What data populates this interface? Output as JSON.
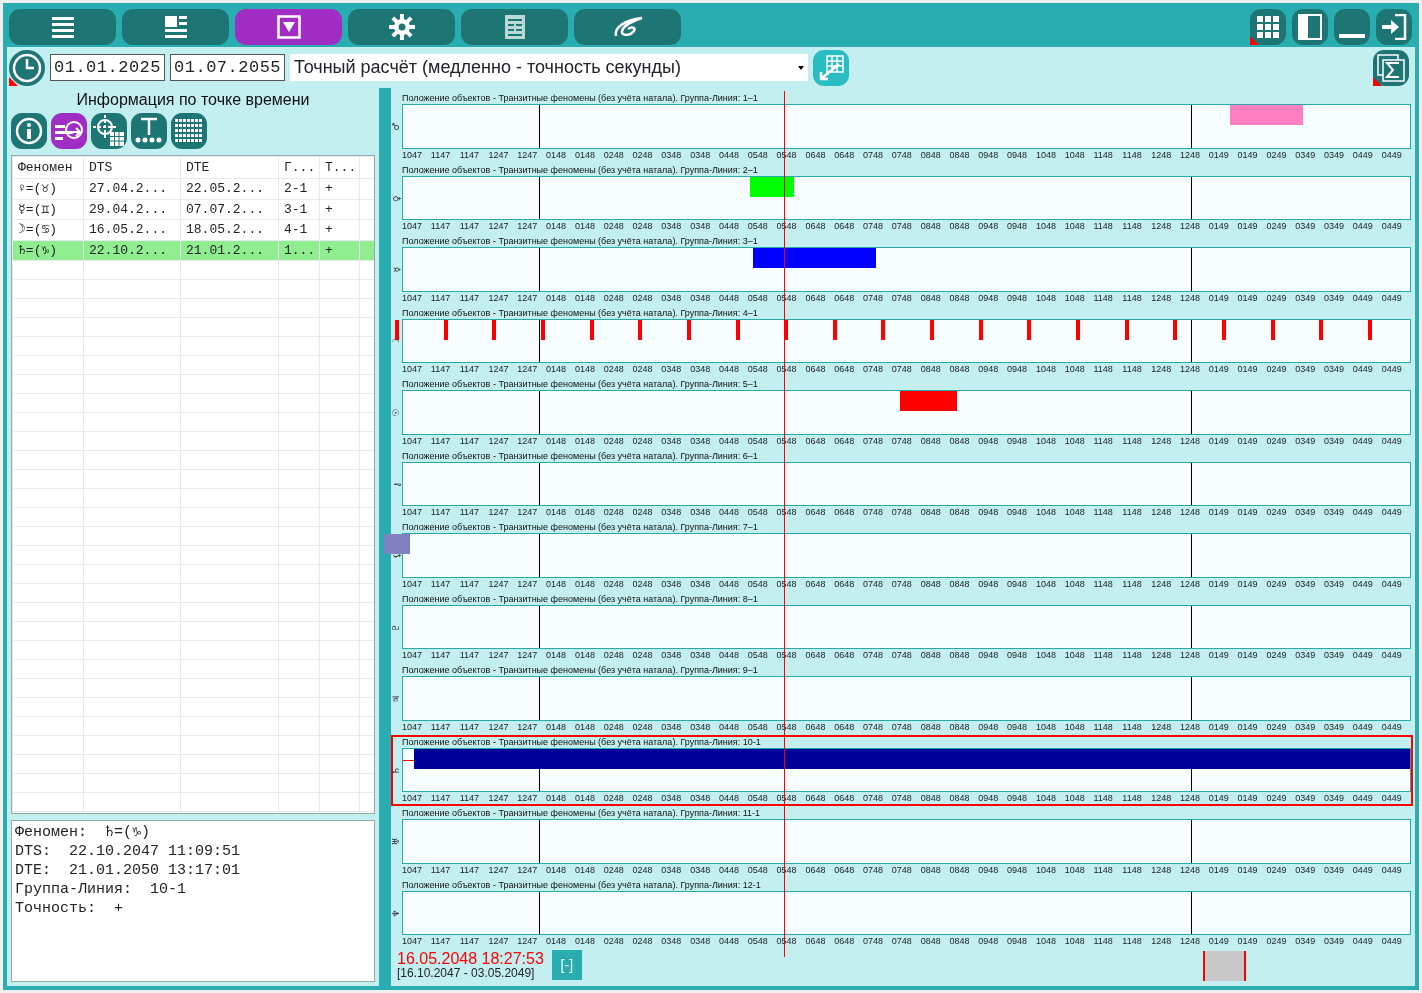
{
  "main_tabs": [
    {
      "selected": false
    },
    {
      "selected": false
    },
    {
      "selected": true
    },
    {
      "selected": false
    },
    {
      "selected": false
    },
    {
      "selected": false
    }
  ],
  "period": {
    "start": "01.01.2025",
    "end": "01.07.2055",
    "mode": "Точный расчёт (медленно - точность секунды)"
  },
  "info_panel": {
    "title": "Информация по точке времени",
    "tools": [
      {
        "selected": false
      },
      {
        "selected": true
      },
      {
        "selected": false
      },
      {
        "selected": false
      },
      {
        "selected": false
      }
    ],
    "table": {
      "columns": [
        "Феномен",
        "DTS",
        "DTE",
        "Г...",
        "Т..."
      ],
      "rows": [
        {
          "cells": [
            "♀=(♉)",
            "27.04.2...",
            "22.05.2...",
            "2-1",
            "+"
          ],
          "selected": false
        },
        {
          "cells": [
            "☿=(♊)",
            "29.04.2...",
            "07.07.2...",
            "3-1",
            "+"
          ],
          "selected": false
        },
        {
          "cells": [
            "☽=(♋)",
            "16.05.2...",
            "18.05.2...",
            "4-1",
            "+"
          ],
          "selected": false
        },
        {
          "cells": [
            "♄=(♑)",
            "22.10.2...",
            "21.01.2...",
            "1...",
            "+"
          ],
          "selected": true
        }
      ]
    },
    "details": [
      "Феномен:  ♄=(♑)",
      "DTS:  22.10.2047 11:09:51",
      "DTE:  21.01.2050 13:17:01",
      "Группа-Линия:  10-1",
      "Точность:  +"
    ]
  },
  "timeline": {
    "tracks": [
      {
        "symbol": "♂",
        "title": "Положение объектов - Транзитные феномены (без учёта натала). Группа-Линия: 1–1",
        "selected": false,
        "mark": {
          "kind": "bar",
          "color": "#ff80c0"
        },
        "ticks": [
          "1047",
          "1147",
          "1147",
          "1247",
          "1247",
          "0148",
          "0148",
          "0248",
          "0248",
          "0348",
          "0348",
          "0448",
          "0548",
          "0548",
          "0648",
          "0648",
          "0748",
          "0748",
          "0848",
          "0848",
          "0948",
          "0948",
          "1048",
          "1048",
          "1148",
          "1148",
          "1248",
          "1248",
          "0149",
          "0149",
          "0249",
          "0349",
          "0349",
          "0449",
          "0449"
        ]
      },
      {
        "symbol": "♀",
        "title": "Положение объектов - Транзитные феномены (без учёта натала). Группа-Линия: 2–1",
        "selected": false,
        "mark": {
          "kind": "bar",
          "color": "#00ff00"
        },
        "ticks": [
          "1047",
          "1147",
          "1147",
          "1247",
          "1247",
          "0148",
          "0148",
          "0248",
          "0248",
          "0348",
          "0348",
          "0448",
          "0548",
          "0548",
          "0648",
          "0648",
          "0748",
          "0748",
          "0848",
          "0848",
          "0948",
          "0948",
          "1048",
          "1048",
          "1148",
          "1148",
          "1248",
          "1248",
          "0149",
          "0149",
          "0249",
          "0349",
          "0349",
          "0449",
          "0449"
        ]
      },
      {
        "symbol": "☿",
        "title": "Положение объектов - Транзитные феномены (без учёта натала). Группа-Линия: 3–1",
        "selected": false,
        "mark": {
          "kind": "bar",
          "color": "#0000ff"
        },
        "ticks": [
          "1047",
          "1147",
          "1147",
          "1247",
          "1247",
          "0148",
          "0148",
          "0248",
          "0248",
          "0348",
          "0348",
          "0448",
          "0548",
          "0548",
          "0648",
          "0648",
          "0748",
          "0748",
          "0848",
          "0848",
          "0948",
          "0948",
          "1048",
          "1048",
          "1148",
          "1148",
          "1248",
          "1248",
          "0149",
          "0149",
          "0249",
          "0349",
          "0349",
          "0449",
          "0449"
        ]
      },
      {
        "symbol": "☽",
        "title": "Положение объектов - Транзитные феномены (без учёта натала). Группа-Линия: 4–1",
        "selected": false,
        "mark": {
          "kind": "ticks",
          "color": "#ff0000"
        },
        "ticks": [
          "1047",
          "1147",
          "1147",
          "1247",
          "1247",
          "0148",
          "0148",
          "0248",
          "0248",
          "0348",
          "0348",
          "0448",
          "0548",
          "0548",
          "0648",
          "0648",
          "0748",
          "0748",
          "0848",
          "0848",
          "0948",
          "0948",
          "1048",
          "1048",
          "1148",
          "1148",
          "1248",
          "1248",
          "0149",
          "0149",
          "0249",
          "0349",
          "0349",
          "0449",
          "0449"
        ]
      },
      {
        "symbol": "☉",
        "title": "Положение объектов - Транзитные феномены (без учёта натала). Группа-Линия: 5–1",
        "selected": false,
        "mark": {
          "kind": "bar",
          "color": "#ff0000"
        },
        "ticks": [
          "1047",
          "1147",
          "1147",
          "1247",
          "1247",
          "0148",
          "0148",
          "0248",
          "0248",
          "0348",
          "0348",
          "0448",
          "0548",
          "0548",
          "0648",
          "0648",
          "0748",
          "0748",
          "0848",
          "0848",
          "0948",
          "0948",
          "1048",
          "1048",
          "1148",
          "1148",
          "1248",
          "1248",
          "0149",
          "0149",
          "0249",
          "0349",
          "0349",
          "0449",
          "0449"
        ]
      },
      {
        "symbol": "⚷",
        "title": "Положение объектов - Транзитные феномены (без учёта натала). Группа-Линия: 6–1",
        "selected": false,
        "ticks": [
          "1047",
          "1147",
          "1147",
          "1247",
          "1247",
          "0148",
          "0148",
          "0248",
          "0248",
          "0348",
          "0348",
          "0448",
          "0548",
          "0548",
          "0648",
          "0648",
          "0748",
          "0748",
          "0848",
          "0848",
          "0948",
          "0948",
          "1048",
          "1048",
          "1148",
          "1148",
          "1248",
          "1248",
          "0149",
          "0149",
          "0249",
          "0349",
          "0349",
          "0449",
          "0449"
        ]
      },
      {
        "symbol": "⚸",
        "title": "Положение объектов - Транзитные феномены (без учёта натала). Группа-Линия: 7–1",
        "selected": false,
        "mark": {
          "kind": "bar",
          "color": "#8080c0"
        },
        "ticks": [
          "1047",
          "1147",
          "1147",
          "1247",
          "1247",
          "0148",
          "0148",
          "0248",
          "0248",
          "0348",
          "0348",
          "0448",
          "0548",
          "0548",
          "0648",
          "0648",
          "0748",
          "0748",
          "0848",
          "0848",
          "0948",
          "0948",
          "1048",
          "1048",
          "1148",
          "1148",
          "1248",
          "1248",
          "0149",
          "0149",
          "0249",
          "0349",
          "0349",
          "0449",
          "0449"
        ]
      },
      {
        "symbol": "♇",
        "title": "Положение объектов - Транзитные феномены (без учёта натала). Группа-Линия: 8–1",
        "selected": false,
        "ticks": [
          "1047",
          "1147",
          "1147",
          "1247",
          "1247",
          "0148",
          "0148",
          "0248",
          "0248",
          "0348",
          "0348",
          "0448",
          "0548",
          "0548",
          "0648",
          "0648",
          "0748",
          "0748",
          "0848",
          "0848",
          "0948",
          "0948",
          "1048",
          "1048",
          "1148",
          "1148",
          "1248",
          "1248",
          "0149",
          "0149",
          "0249",
          "0349",
          "0349",
          "0449",
          "0449"
        ]
      },
      {
        "symbol": "♃",
        "title": "Положение объектов - Транзитные феномены (без учёта натала). Группа-Линия: 9–1",
        "selected": false,
        "ticks": [
          "1047",
          "1147",
          "1147",
          "1247",
          "1247",
          "0148",
          "0148",
          "0248",
          "0248",
          "0348",
          "0348",
          "0448",
          "0548",
          "0548",
          "0648",
          "0648",
          "0748",
          "0748",
          "0848",
          "0848",
          "0948",
          "0948",
          "1048",
          "1048",
          "1148",
          "1148",
          "1248",
          "1248",
          "0149",
          "0149",
          "0249",
          "0349",
          "0349",
          "0449",
          "0449"
        ]
      },
      {
        "symbol": "♄",
        "title": "Положение объектов - Транзитные феномены (без учёта натала). Группа-Линия: 10-1",
        "selected": true,
        "mark": {
          "kind": "bar",
          "color": "#000099"
        },
        "ticks": [
          "1047",
          "1147",
          "1147",
          "1247",
          "1247",
          "0148",
          "0148",
          "0248",
          "0248",
          "0348",
          "0348",
          "0448",
          "0548",
          "0548",
          "0648",
          "0648",
          "0748",
          "0748",
          "0848",
          "0848",
          "0948",
          "0948",
          "1048",
          "1048",
          "1148",
          "1148",
          "1248",
          "1248",
          "0149",
          "0149",
          "0249",
          "0349",
          "0349",
          "0449",
          "0449"
        ]
      },
      {
        "symbol": "♅",
        "title": "Положение объектов - Транзитные феномены (без учёта натала). Группа-Линия: 11-1",
        "selected": false,
        "ticks": [
          "1047",
          "1147",
          "1147",
          "1247",
          "1247",
          "0148",
          "0148",
          "0248",
          "0248",
          "0348",
          "0348",
          "0448",
          "0548",
          "0548",
          "0648",
          "0648",
          "0748",
          "0748",
          "0848",
          "0848",
          "0948",
          "0948",
          "1048",
          "1048",
          "1148",
          "1148",
          "1248",
          "1248",
          "0149",
          "0149",
          "0249",
          "0349",
          "0349",
          "0449",
          "0449"
        ]
      },
      {
        "symbol": "♆",
        "title": "Положение объектов - Транзитные феномены (без учёта натала). Группа-Линия: 12-1",
        "selected": false,
        "ticks": [
          "1047",
          "1147",
          "1147",
          "1247",
          "1247",
          "0148",
          "0148",
          "0248",
          "0248",
          "0348",
          "0348",
          "0448",
          "0548",
          "0548",
          "0648",
          "0648",
          "0748",
          "0748",
          "0848",
          "0848",
          "0948",
          "0948",
          "1048",
          "1048",
          "1148",
          "1148",
          "1248",
          "1248",
          "0149",
          "0149",
          "0249",
          "0349",
          "0349",
          "0449",
          "0449"
        ]
      }
    ],
    "cursor_time": "16.05.2048 18:27:53",
    "range": "[16.10.2047 - 03.05.2049]",
    "zoom_button": "[-]"
  }
}
